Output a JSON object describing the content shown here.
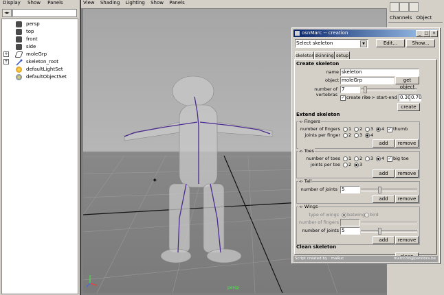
{
  "outliner": {
    "menu": [
      "Display",
      "Show",
      "Panels"
    ],
    "items": [
      {
        "label": "persp",
        "icon": "camera-icon",
        "expandable": false
      },
      {
        "label": "top",
        "icon": "camera-icon",
        "expandable": false
      },
      {
        "label": "front",
        "icon": "camera-icon",
        "expandable": false
      },
      {
        "label": "side",
        "icon": "camera-icon",
        "expandable": false
      },
      {
        "label": "moleGrp",
        "icon": "group-icon",
        "expandable": true
      },
      {
        "label": "skeleton_root",
        "icon": "joint-icon",
        "expandable": true
      },
      {
        "label": "defaultLightSet",
        "icon": "light-set-icon",
        "expandable": false
      },
      {
        "label": "defaultObjectSet",
        "icon": "object-set-icon",
        "expandable": false
      }
    ]
  },
  "viewport": {
    "menu": [
      "View",
      "Shading",
      "Lighting",
      "Show",
      "Panels"
    ],
    "camera_label": "persp"
  },
  "channel_box": {
    "tabs": [
      "Channels",
      "Object"
    ]
  },
  "dialog": {
    "title": "osnMarc -- creation",
    "select_value": "Select skeleton",
    "edit_label": "Edit...",
    "show_label": "Show...",
    "tabs": [
      "skeleton",
      "skinning",
      "setup"
    ],
    "create": {
      "heading": "Create skeleton",
      "name_label": "name",
      "name_value": "skeleton",
      "object_label": "object",
      "object_value": "moleGrp",
      "get_object": "get object",
      "vertebras_label": "number of vertebras",
      "vertebras_value": "7",
      "vertebras_level": 0.05,
      "ribs_label": "create ribs",
      "ribs_checked": true,
      "startend_label": "----> start-end",
      "start_value": "0.30",
      "end_value": "0.70",
      "create_button": "create"
    },
    "extend": {
      "heading": "Extend skeleton",
      "fingers": {
        "label": "Fingers",
        "count_label": "number of fingers",
        "count_options": [
          "1",
          "2",
          "3",
          "4"
        ],
        "count_selected": "4",
        "thumb_label": "thumb",
        "thumb_checked": true,
        "joints_label": "joints per finger",
        "joint_options": [
          "2",
          "3",
          "4"
        ],
        "joint_selected": "4",
        "add": "add",
        "remove": "remove"
      },
      "toes": {
        "label": "Toes",
        "count_label": "number of toes",
        "count_options": [
          "1",
          "2",
          "3",
          "4"
        ],
        "count_selected": "4",
        "bigtoe_label": "big toe",
        "bigtoe_checked": true,
        "joints_label": "joints per toe",
        "joint_options": [
          "2",
          "3"
        ],
        "joint_selected": "3",
        "add": "add",
        "remove": "remove"
      },
      "tail": {
        "label": "Tail",
        "joints_label": "number of joints",
        "joints_value": "5",
        "joints_level": 0.33,
        "add": "add",
        "remove": "remove"
      },
      "wings": {
        "label": "Wings",
        "type_label": "type of wings",
        "type_options": [
          "batwing",
          "bird"
        ],
        "type_selected": "batwing",
        "fingers_label": "number of fingers",
        "fingers_value": "",
        "joints_label": "number of joints",
        "joints_value": "5",
        "joints_level": 0.33,
        "add": "add",
        "remove": "remove"
      }
    },
    "clean": {
      "heading": "Clean skeleton",
      "clean_button": "clean"
    },
    "footer_left": "Script created by : maRuc",
    "footer_right": "marco3d@pandora.be"
  }
}
